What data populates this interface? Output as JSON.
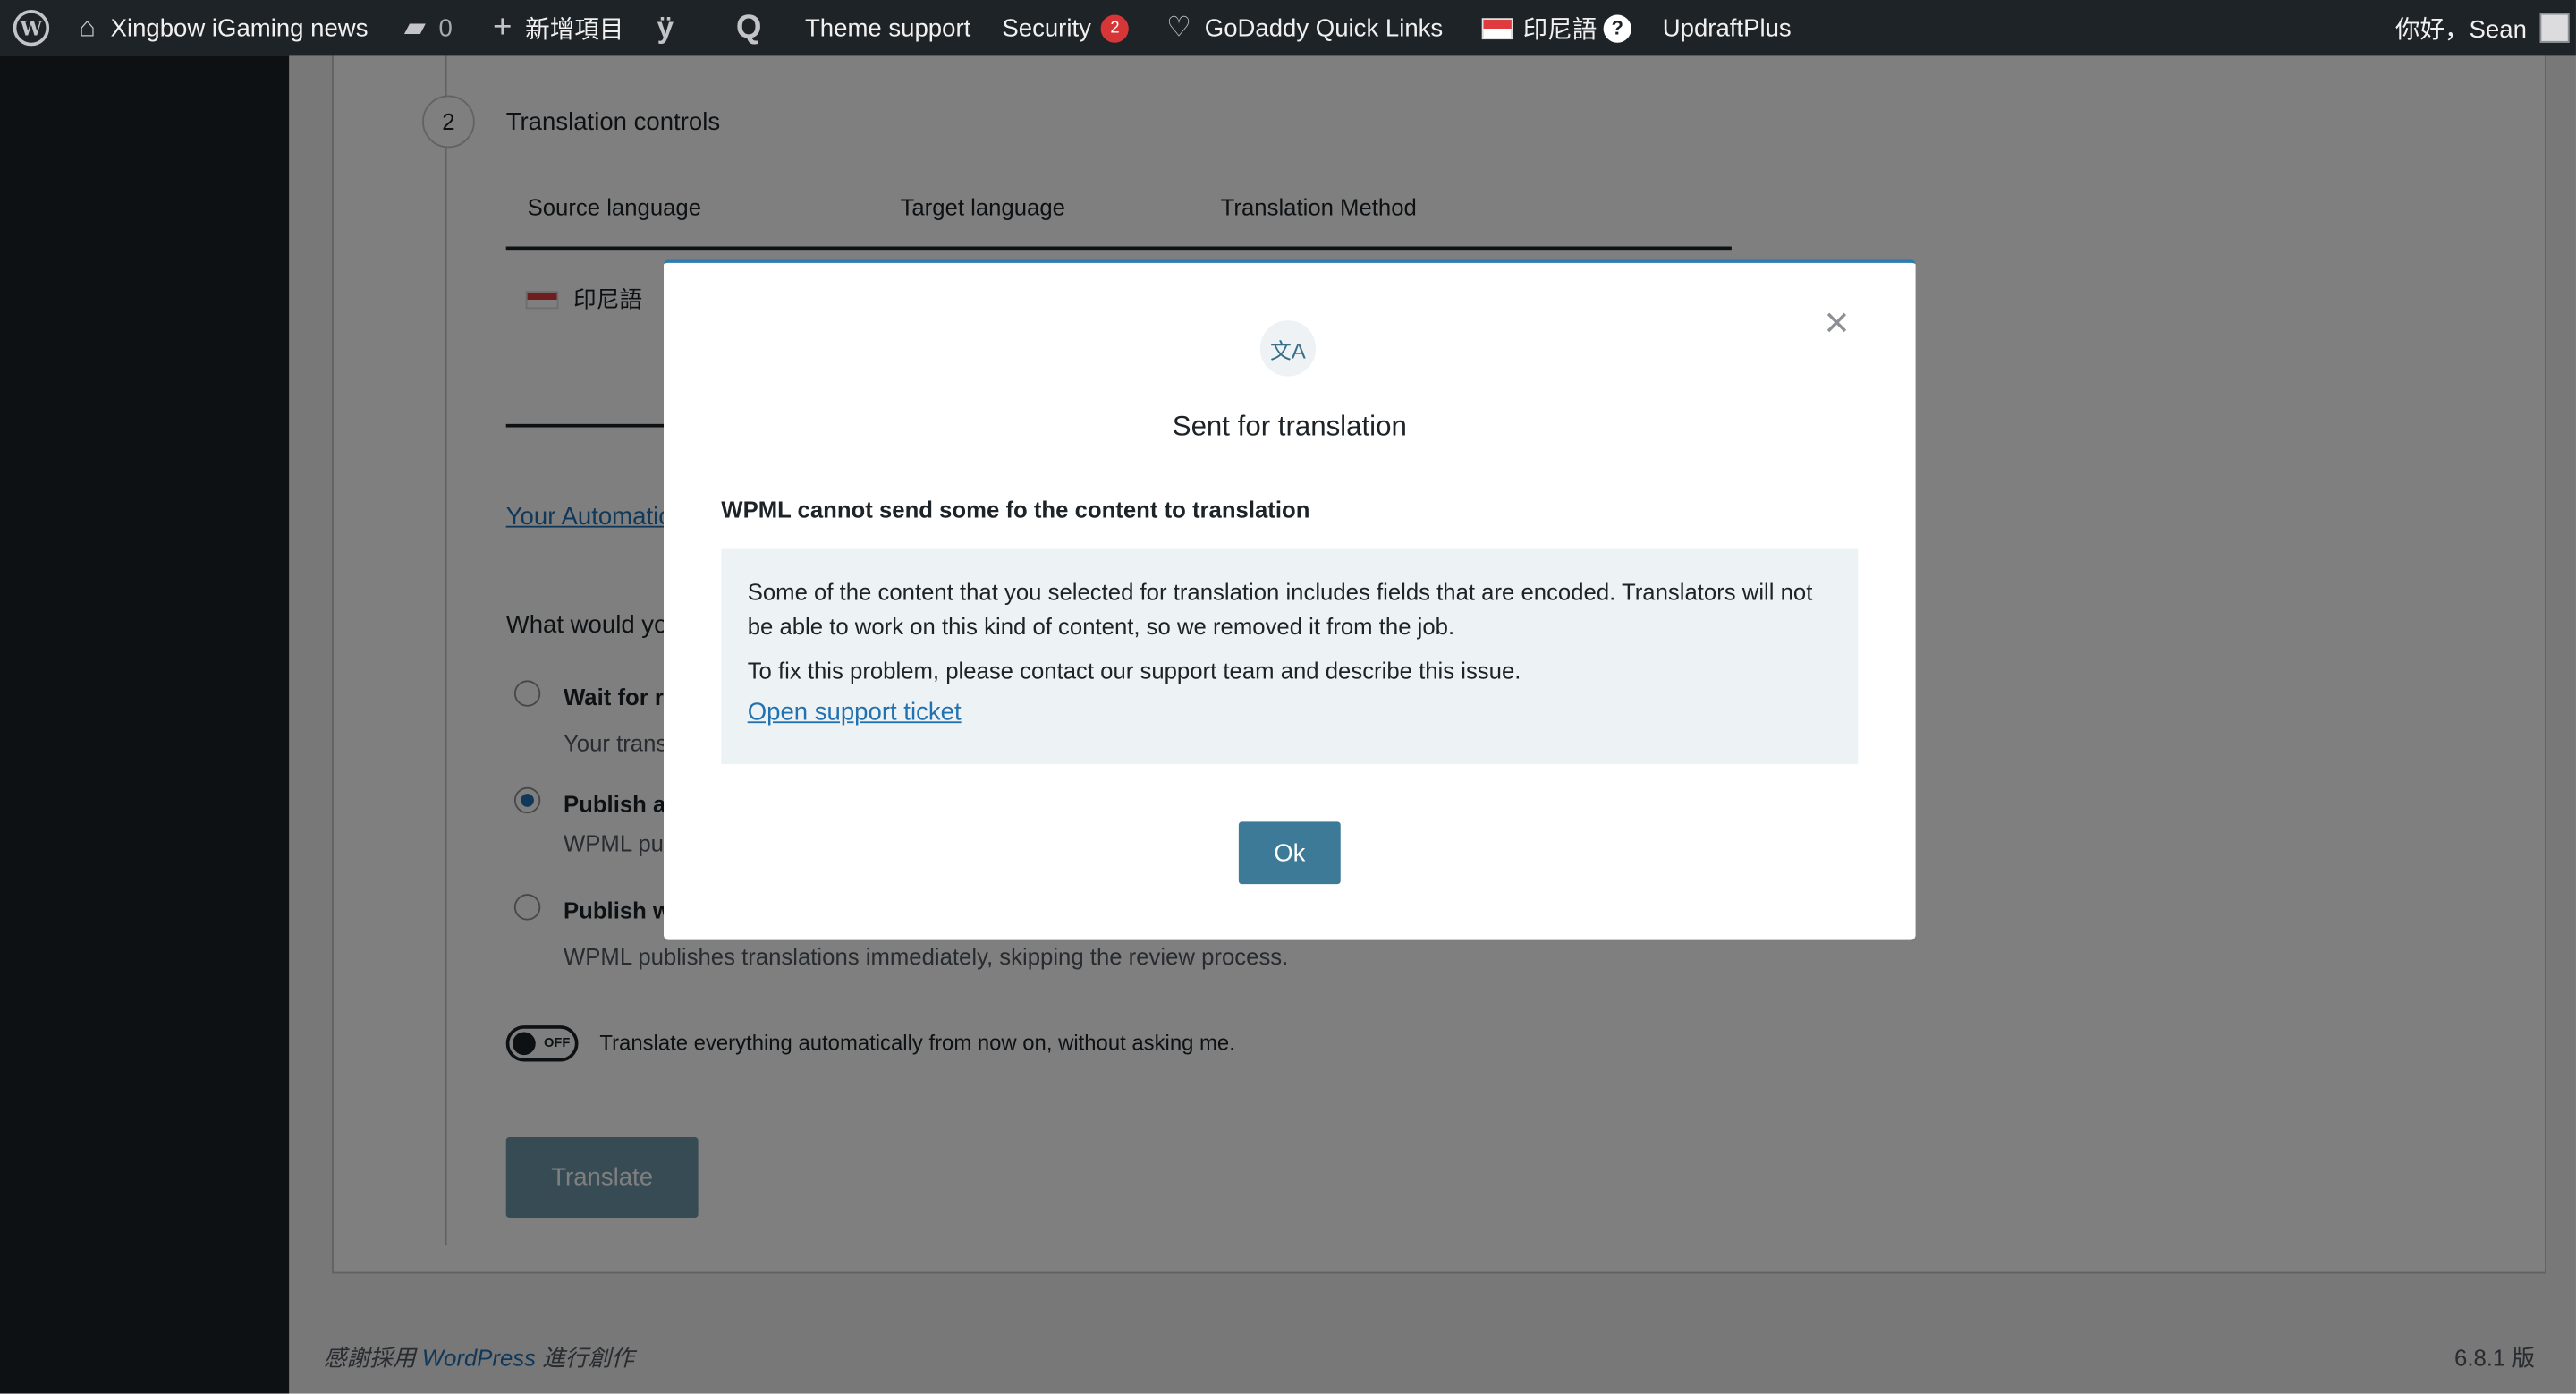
{
  "adminbar": {
    "site_name": "Xingbow iGaming news",
    "comments_count": "0",
    "new_label": "新增項目",
    "theme_support": "Theme support",
    "security_label": "Security",
    "security_badge": "2",
    "godaddy": "GoDaddy Quick Links",
    "language": "印尼語",
    "help_symbol": "?",
    "updraft": "UpdraftPlus",
    "greeting": "你好，Sean"
  },
  "step": {
    "number": "2",
    "title": "Translation controls"
  },
  "table": {
    "headers": [
      "Source language",
      "Target language",
      "Translation Method"
    ],
    "source_language": "印尼語"
  },
  "link_automatic": "Your Automatic Tr",
  "question": "What would you l",
  "options": [
    {
      "title": "Wait for revie",
      "desc": "Your translato",
      "checked": false
    },
    {
      "title": "Publish and r",
      "desc": "WPML publis",
      "checked": true
    },
    {
      "title": "Publish witho",
      "desc": "WPML publishes translations immediately, skipping the review process.",
      "checked": false
    }
  ],
  "toggle": {
    "state": "OFF",
    "label": "Translate everything automatically from now on, without asking me."
  },
  "translate_button": "Translate",
  "footer": {
    "thanks_prefix": "感謝採用 ",
    "wordpress": "WordPress",
    "thanks_suffix": " 進行創作",
    "version": "6.8.1 版"
  },
  "modal": {
    "icon_text": "文A",
    "title": "Sent for translation",
    "subtitle": "WPML cannot send some fo the content to translation",
    "notice_p1": "Some of the content that you selected for translation includes fields that are encoded. Translators will not be able to work on this kind of content, so we removed it from the job.",
    "notice_p2": "To fix this problem, please contact our support team and describe this issue.",
    "support_link": "Open support ticket",
    "ok_label": "Ok",
    "close_symbol": "×"
  },
  "colors": {
    "adminbar": "#1d2327",
    "link": "#2271b1",
    "ok_button": "#3d7a97",
    "notice_bg": "#edf2f4"
  }
}
